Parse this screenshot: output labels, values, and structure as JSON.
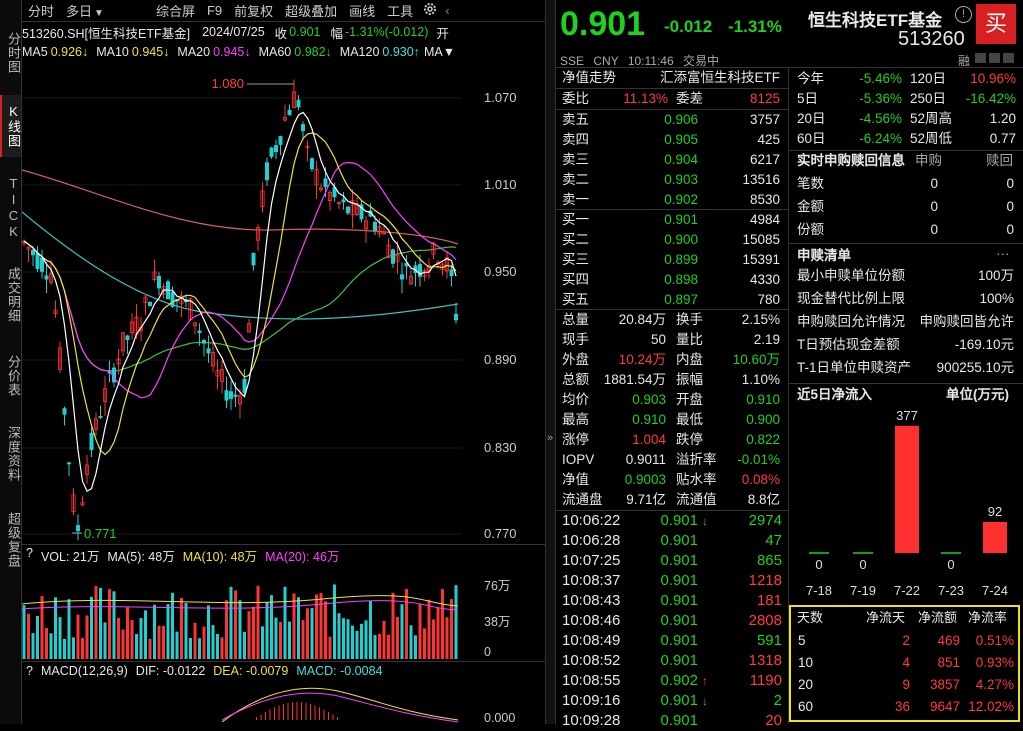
{
  "left_tabs": [
    "分时图",
    "K线图",
    "TICK",
    "成交明细",
    "分价表",
    "深度资料",
    "超级复盘"
  ],
  "toolbar": {
    "items": [
      "分时",
      "多日",
      "综合屏",
      "F9",
      "前复权",
      "超级叠加",
      "画线",
      "工具"
    ],
    "multiday_arrow": "▼"
  },
  "info": {
    "code": "513260.SH[恒生科技ETF基金]",
    "date": "2024/07/25",
    "close_label": "收",
    "close": "0.901",
    "range_label": "幅",
    "range": "-1.31%(-0.012)",
    "open_label": "开"
  },
  "ma": {
    "ma5_label": "MA5",
    "ma5": "0.926↓",
    "ma10_label": "MA10",
    "ma10": "0.945↓",
    "ma20_label": "MA20",
    "ma20": "0.945↓",
    "ma60_label": "MA60",
    "ma60": "0.982↓",
    "ma120_label": "MA120",
    "ma120": "0.930↑",
    "more": "MA▼"
  },
  "kchart": {
    "ticks": [
      "1.070",
      "1.010",
      "0.950",
      "0.890",
      "0.830",
      "0.770"
    ],
    "high": "1.080",
    "low": "0.771"
  },
  "volbar": {
    "help": "?",
    "vol": "VOL: 21万",
    "ma5": "MA(5): 48万",
    "ma10": "MA(10): 48万",
    "ma20": "MA(20): 46万",
    "ticks": [
      "76万",
      "38万",
      "0"
    ]
  },
  "macdbar": {
    "help": "?",
    "macd_title": "MACD(12,26,9)",
    "dif": "DIF: -0.0122",
    "dea": "DEA: -0.0079",
    "macd": "MACD: -0.0084",
    "tick": "0.000"
  },
  "header": {
    "price": "0.901",
    "change": "-0.012",
    "pct": "-1.31%",
    "name": "恒生科技ETF基金",
    "code": "513260",
    "exchange": "SSE",
    "currency": "CNY",
    "time": "10:11:46",
    "status": "交易中",
    "buy_btn": "买",
    "rong": "融"
  },
  "quote": {
    "nav_title": "净值走势",
    "nav_name": "汇添富恒生科技ETF",
    "weibi_label": "委比",
    "weibi": "11.13%",
    "weicha_label": "委差",
    "weicha": "8125",
    "sells": [
      {
        "label": "卖五",
        "price": "0.906",
        "vol": "3757"
      },
      {
        "label": "卖四",
        "price": "0.905",
        "vol": "425"
      },
      {
        "label": "卖三",
        "price": "0.904",
        "vol": "6217"
      },
      {
        "label": "卖二",
        "price": "0.903",
        "vol": "13516"
      },
      {
        "label": "卖一",
        "price": "0.902",
        "vol": "8530"
      }
    ],
    "buys": [
      {
        "label": "买一",
        "price": "0.901",
        "vol": "4984"
      },
      {
        "label": "买二",
        "price": "0.900",
        "vol": "15085"
      },
      {
        "label": "买三",
        "price": "0.899",
        "vol": "15391"
      },
      {
        "label": "买四",
        "price": "0.898",
        "vol": "4330"
      },
      {
        "label": "买五",
        "price": "0.897",
        "vol": "780"
      }
    ],
    "stats": [
      {
        "l1": "总量",
        "v1": "20.84万",
        "c1": "white",
        "l2": "换手",
        "v2": "2.15%",
        "c2": "white"
      },
      {
        "l1": "现手",
        "v1": "50",
        "c1": "white",
        "l2": "量比",
        "v2": "2.19",
        "c2": "white"
      },
      {
        "l1": "外盘",
        "v1": "10.24万",
        "c1": "red",
        "l2": "内盘",
        "v2": "10.60万",
        "c2": "green"
      },
      {
        "l1": "总额",
        "v1": "1881.54万",
        "c1": "white",
        "l2": "振幅",
        "v2": "1.10%",
        "c2": "white"
      },
      {
        "l1": "均价",
        "v1": "0.903",
        "c1": "green",
        "l2": "开盘",
        "v2": "0.910",
        "c2": "green"
      },
      {
        "l1": "最高",
        "v1": "0.910",
        "c1": "green",
        "l2": "最低",
        "v2": "0.900",
        "c2": "green"
      },
      {
        "l1": "涨停",
        "v1": "1.004",
        "c1": "red",
        "l2": "跌停",
        "v2": "0.822",
        "c2": "green"
      },
      {
        "l1": "IOPV",
        "v1": "0.9011",
        "c1": "white",
        "l2": "溢折率",
        "v2": "-0.01%",
        "c2": "green"
      },
      {
        "l1": "净值",
        "v1": "0.9003",
        "c1": "green",
        "l2": "贴水率",
        "v2": "0.08%",
        "c2": "red"
      },
      {
        "l1": "流通盘",
        "v1": "9.71亿",
        "c1": "white",
        "l2": "流通值",
        "v2": "8.8亿",
        "c2": "white"
      }
    ],
    "ticks": [
      {
        "t": "10:06:22",
        "p": "0.901",
        "arrow": "↓",
        "v": "2974",
        "vc": "green",
        "ac": "green"
      },
      {
        "t": "10:06:28",
        "p": "0.901",
        "arrow": "",
        "v": "47",
        "vc": "green",
        "ac": "green"
      },
      {
        "t": "10:07:25",
        "p": "0.901",
        "arrow": "",
        "v": "865",
        "vc": "green",
        "ac": "green"
      },
      {
        "t": "10:08:37",
        "p": "0.901",
        "arrow": "",
        "v": "1218",
        "vc": "red",
        "ac": "green"
      },
      {
        "t": "10:08:43",
        "p": "0.901",
        "arrow": "",
        "v": "181",
        "vc": "red",
        "ac": "green"
      },
      {
        "t": "10:08:46",
        "p": "0.901",
        "arrow": "",
        "v": "2808",
        "vc": "red",
        "ac": "green"
      },
      {
        "t": "10:08:49",
        "p": "0.901",
        "arrow": "",
        "v": "591",
        "vc": "green",
        "ac": "green"
      },
      {
        "t": "10:08:52",
        "p": "0.901",
        "arrow": "",
        "v": "1318",
        "vc": "red",
        "ac": "green"
      },
      {
        "t": "10:08:55",
        "p": "0.902",
        "arrow": "↑",
        "v": "1190",
        "vc": "red",
        "ac": "red"
      },
      {
        "t": "10:09:16",
        "p": "0.901",
        "arrow": "↓",
        "v": "2",
        "vc": "green",
        "ac": "green"
      },
      {
        "t": "10:09:28",
        "p": "0.901",
        "arrow": "",
        "v": "20",
        "vc": "red",
        "ac": "green"
      }
    ]
  },
  "perf": [
    {
      "l1": "今年",
      "v1": "-5.46%",
      "c1": "green",
      "l2": "120日",
      "v2": "10.96%",
      "c2": "red"
    },
    {
      "l1": "5日",
      "v1": "-5.36%",
      "c1": "green",
      "l2": "250日",
      "v2": "-16.42%",
      "c2": "green"
    },
    {
      "l1": "20日",
      "v1": "-4.56%",
      "c1": "green",
      "l2": "52周高",
      "v2": "1.20",
      "c2": "white"
    },
    {
      "l1": "60日",
      "v1": "-6.24%",
      "c1": "green",
      "l2": "52周低",
      "v2": "0.77",
      "c2": "white"
    }
  ],
  "redeem": {
    "title": "实时申购赎回信息",
    "col1": "申购",
    "col2": "赎回",
    "rows": [
      {
        "l": "笔数",
        "a": "0",
        "b": "0"
      },
      {
        "l": "金额",
        "a": "0",
        "b": "0"
      },
      {
        "l": "份额",
        "a": "0",
        "b": "0"
      }
    ],
    "more": "···"
  },
  "list": {
    "title": "申赎清单",
    "rows": [
      {
        "l": "最小申赎单位份额",
        "v": "100万"
      },
      {
        "l": "现金替代比例上限",
        "v": "100%"
      },
      {
        "l": "申购赎回允许情况",
        "v": "申购赎回皆允许"
      },
      {
        "l": "T日预估现金差额",
        "v": "-169.10元"
      },
      {
        "l": "T-1日单位申赎资产",
        "v": "900255.10元"
      }
    ]
  },
  "flow": {
    "title": "近5日净流入",
    "unit": "单位(万元)"
  },
  "chart_data": {
    "type": "bar",
    "categories": [
      "7-18",
      "7-19",
      "7-22",
      "7-23",
      "7-24"
    ],
    "values": [
      0,
      0,
      377,
      0,
      92
    ],
    "labels": [
      "0",
      "0",
      "377",
      "0",
      "92"
    ],
    "bar_color": "#ff3030",
    "zero_color": "#1fd11f"
  },
  "flowtable": {
    "headers": [
      "天数",
      "净流天",
      "净流额",
      "净流率"
    ],
    "rows": [
      [
        "5",
        "2",
        "469",
        "0.51%"
      ],
      [
        "10",
        "4",
        "851",
        "0.93%"
      ],
      [
        "20",
        "9",
        "3857",
        "4.27%"
      ],
      [
        "60",
        "36",
        "9647",
        "12.02%"
      ]
    ]
  }
}
